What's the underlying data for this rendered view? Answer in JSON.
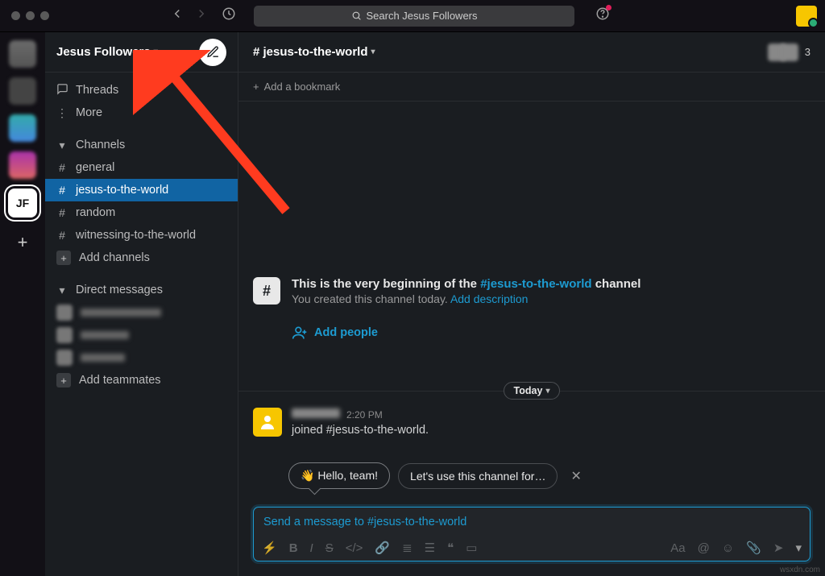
{
  "toolbar": {
    "search_placeholder": "Search Jesus Followers"
  },
  "workspace": {
    "name": "Jesus Followers",
    "initials": "JF"
  },
  "sidebar": {
    "threads": "Threads",
    "more": "More",
    "channels_label": "Channels",
    "channels": [
      {
        "name": "general"
      },
      {
        "name": "jesus-to-the-world",
        "selected": true
      },
      {
        "name": "random"
      },
      {
        "name": "witnessing-to-the-world"
      }
    ],
    "add_channels": "Add channels",
    "dms_label": "Direct messages",
    "add_teammates": "Add teammates"
  },
  "channel": {
    "name": "# jesus-to-the-world",
    "member_count": "3",
    "add_bookmark": "Add a bookmark",
    "begin_prefix": "This is the very beginning of the ",
    "begin_link": "#jesus-to-the-world",
    "begin_suffix": " channel",
    "created": "You created this channel today. ",
    "add_description": "Add description",
    "add_people": "Add people",
    "divider": "Today",
    "msg_time": "2:20 PM",
    "msg_text": "joined #jesus-to-the-world.",
    "chip1": "👋 Hello, team!",
    "chip2": "Let's use this channel for…",
    "composer_placeholder": "Send a message to #jesus-to-the-world"
  },
  "watermark": "wsxdn.com"
}
